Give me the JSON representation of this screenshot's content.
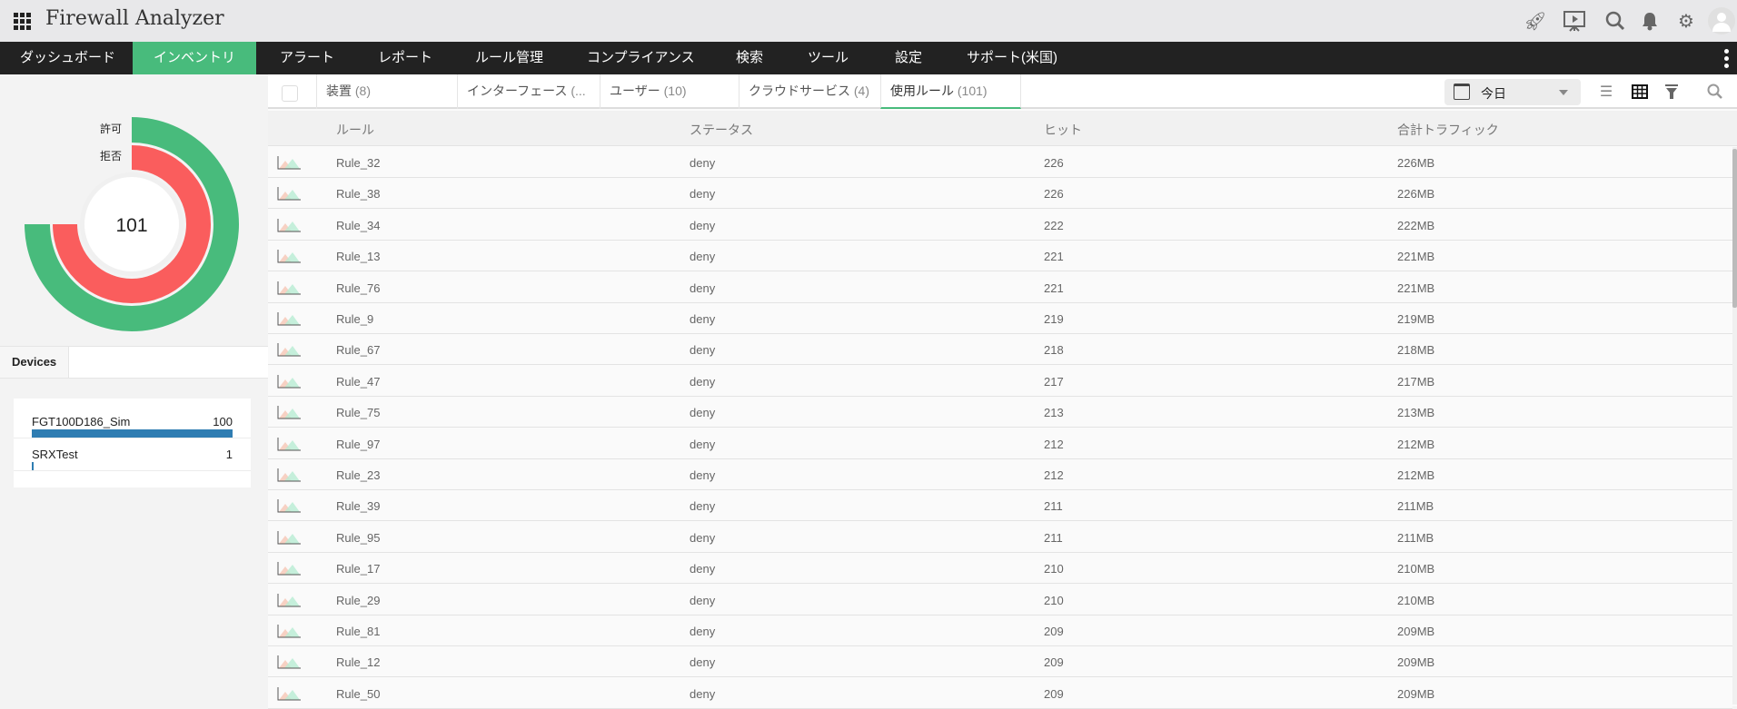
{
  "header": {
    "title": "Firewall Analyzer",
    "icons": [
      "rocket-icon",
      "presentation-icon",
      "search-icon",
      "bell-icon",
      "gear-icon",
      "user-avatar-icon"
    ]
  },
  "nav": {
    "items": [
      "ダッシュボード",
      "インベントリ",
      "アラート",
      "レポート",
      "ルール管理",
      "コンプライアンス",
      "検索",
      "ツール",
      "設定",
      "サポート(米国)"
    ],
    "active": 1
  },
  "chart_data": {
    "type": "radial-bar",
    "center_label": "101",
    "series": [
      {
        "name": "許可",
        "fraction": 0.75,
        "color": "#48bb7c"
      },
      {
        "name": "拒否",
        "fraction": 0.75,
        "color": "#fa5d5d"
      }
    ]
  },
  "devices": {
    "tab": "Devices",
    "items": [
      {
        "name": "FGT100D186_Sim",
        "count": "100",
        "fraction": 1.0
      },
      {
        "name": "SRXTest",
        "count": "1",
        "fraction": 0.01
      }
    ]
  },
  "tabs": [
    {
      "label": "装置",
      "count": "(8)"
    },
    {
      "label": "インターフェース",
      "count": "(..."
    },
    {
      "label": "ユーザー",
      "count": "(10)"
    },
    {
      "label": "クラウドサービス",
      "count": "(4)"
    },
    {
      "label": "使用ルール",
      "count": "(101)"
    }
  ],
  "toolbar": {
    "date": "今日"
  },
  "table": {
    "columns": [
      "ルール",
      "ステータス",
      "ヒット",
      "合計トラフィック"
    ],
    "rows": [
      [
        "Rule_32",
        "deny",
        "226",
        "226MB"
      ],
      [
        "Rule_38",
        "deny",
        "226",
        "226MB"
      ],
      [
        "Rule_34",
        "deny",
        "222",
        "222MB"
      ],
      [
        "Rule_13",
        "deny",
        "221",
        "221MB"
      ],
      [
        "Rule_76",
        "deny",
        "221",
        "221MB"
      ],
      [
        "Rule_9",
        "deny",
        "219",
        "219MB"
      ],
      [
        "Rule_67",
        "deny",
        "218",
        "218MB"
      ],
      [
        "Rule_47",
        "deny",
        "217",
        "217MB"
      ],
      [
        "Rule_75",
        "deny",
        "213",
        "213MB"
      ],
      [
        "Rule_97",
        "deny",
        "212",
        "212MB"
      ],
      [
        "Rule_23",
        "deny",
        "212",
        "212MB"
      ],
      [
        "Rule_39",
        "deny",
        "211",
        "211MB"
      ],
      [
        "Rule_95",
        "deny",
        "211",
        "211MB"
      ],
      [
        "Rule_17",
        "deny",
        "210",
        "210MB"
      ],
      [
        "Rule_29",
        "deny",
        "210",
        "210MB"
      ],
      [
        "Rule_81",
        "deny",
        "209",
        "209MB"
      ],
      [
        "Rule_12",
        "deny",
        "209",
        "209MB"
      ],
      [
        "Rule_50",
        "deny",
        "209",
        "209MB"
      ]
    ]
  }
}
